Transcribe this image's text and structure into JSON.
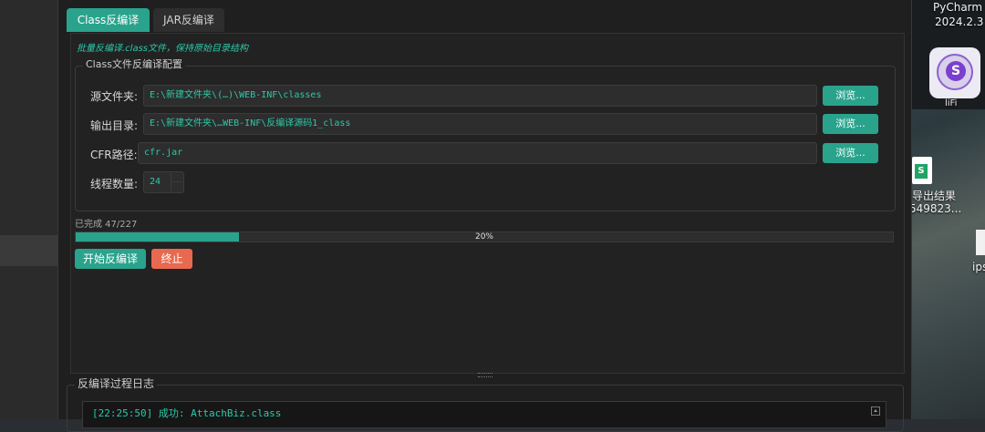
{
  "desktop": {
    "right_top_app": "PyCharm",
    "right_top_version": "2024.2.3",
    "icon_s_letter": "S",
    "icon_s_label": "liFi",
    "sheet_letter": "S",
    "sheet_label_1": "导出结果",
    "sheet_label_2": "549823...",
    "doc_label": "ips"
  },
  "tabs": [
    {
      "label": "Class反编译",
      "active": true
    },
    {
      "label": "JAR反编译",
      "active": false
    }
  ],
  "description": "批量反编译.class文件，保持原始目录结构",
  "config": {
    "group_title": "Class文件反编译配置",
    "fields": [
      {
        "label": "源文件夹:",
        "value": "E:\\新建文件夹\\(…)\\WEB-INF\\classes",
        "button": "浏览..."
      },
      {
        "label": "输出目录:",
        "value": "E:\\新建文件夹\\…WEB-INF\\反编译源码1_class",
        "button": "浏览..."
      },
      {
        "label": "CFR路径:",
        "value": "cfr.jar",
        "button": "浏览..."
      }
    ],
    "threads_label": "线程数量:",
    "threads_value": "24"
  },
  "progress": {
    "status_text": "已完成 47/227",
    "percent_text": "20%",
    "fraction": 0.2
  },
  "actions": {
    "start_label": "开始反编译",
    "stop_label": "终止"
  },
  "log": {
    "title": "反编译过程日志",
    "lines": [
      "[22:25:50] 成功: AttachBiz.class"
    ]
  },
  "colors": {
    "accent": "#2aa38c",
    "danger": "#e8694f",
    "text_accent": "#2bc9a9"
  }
}
